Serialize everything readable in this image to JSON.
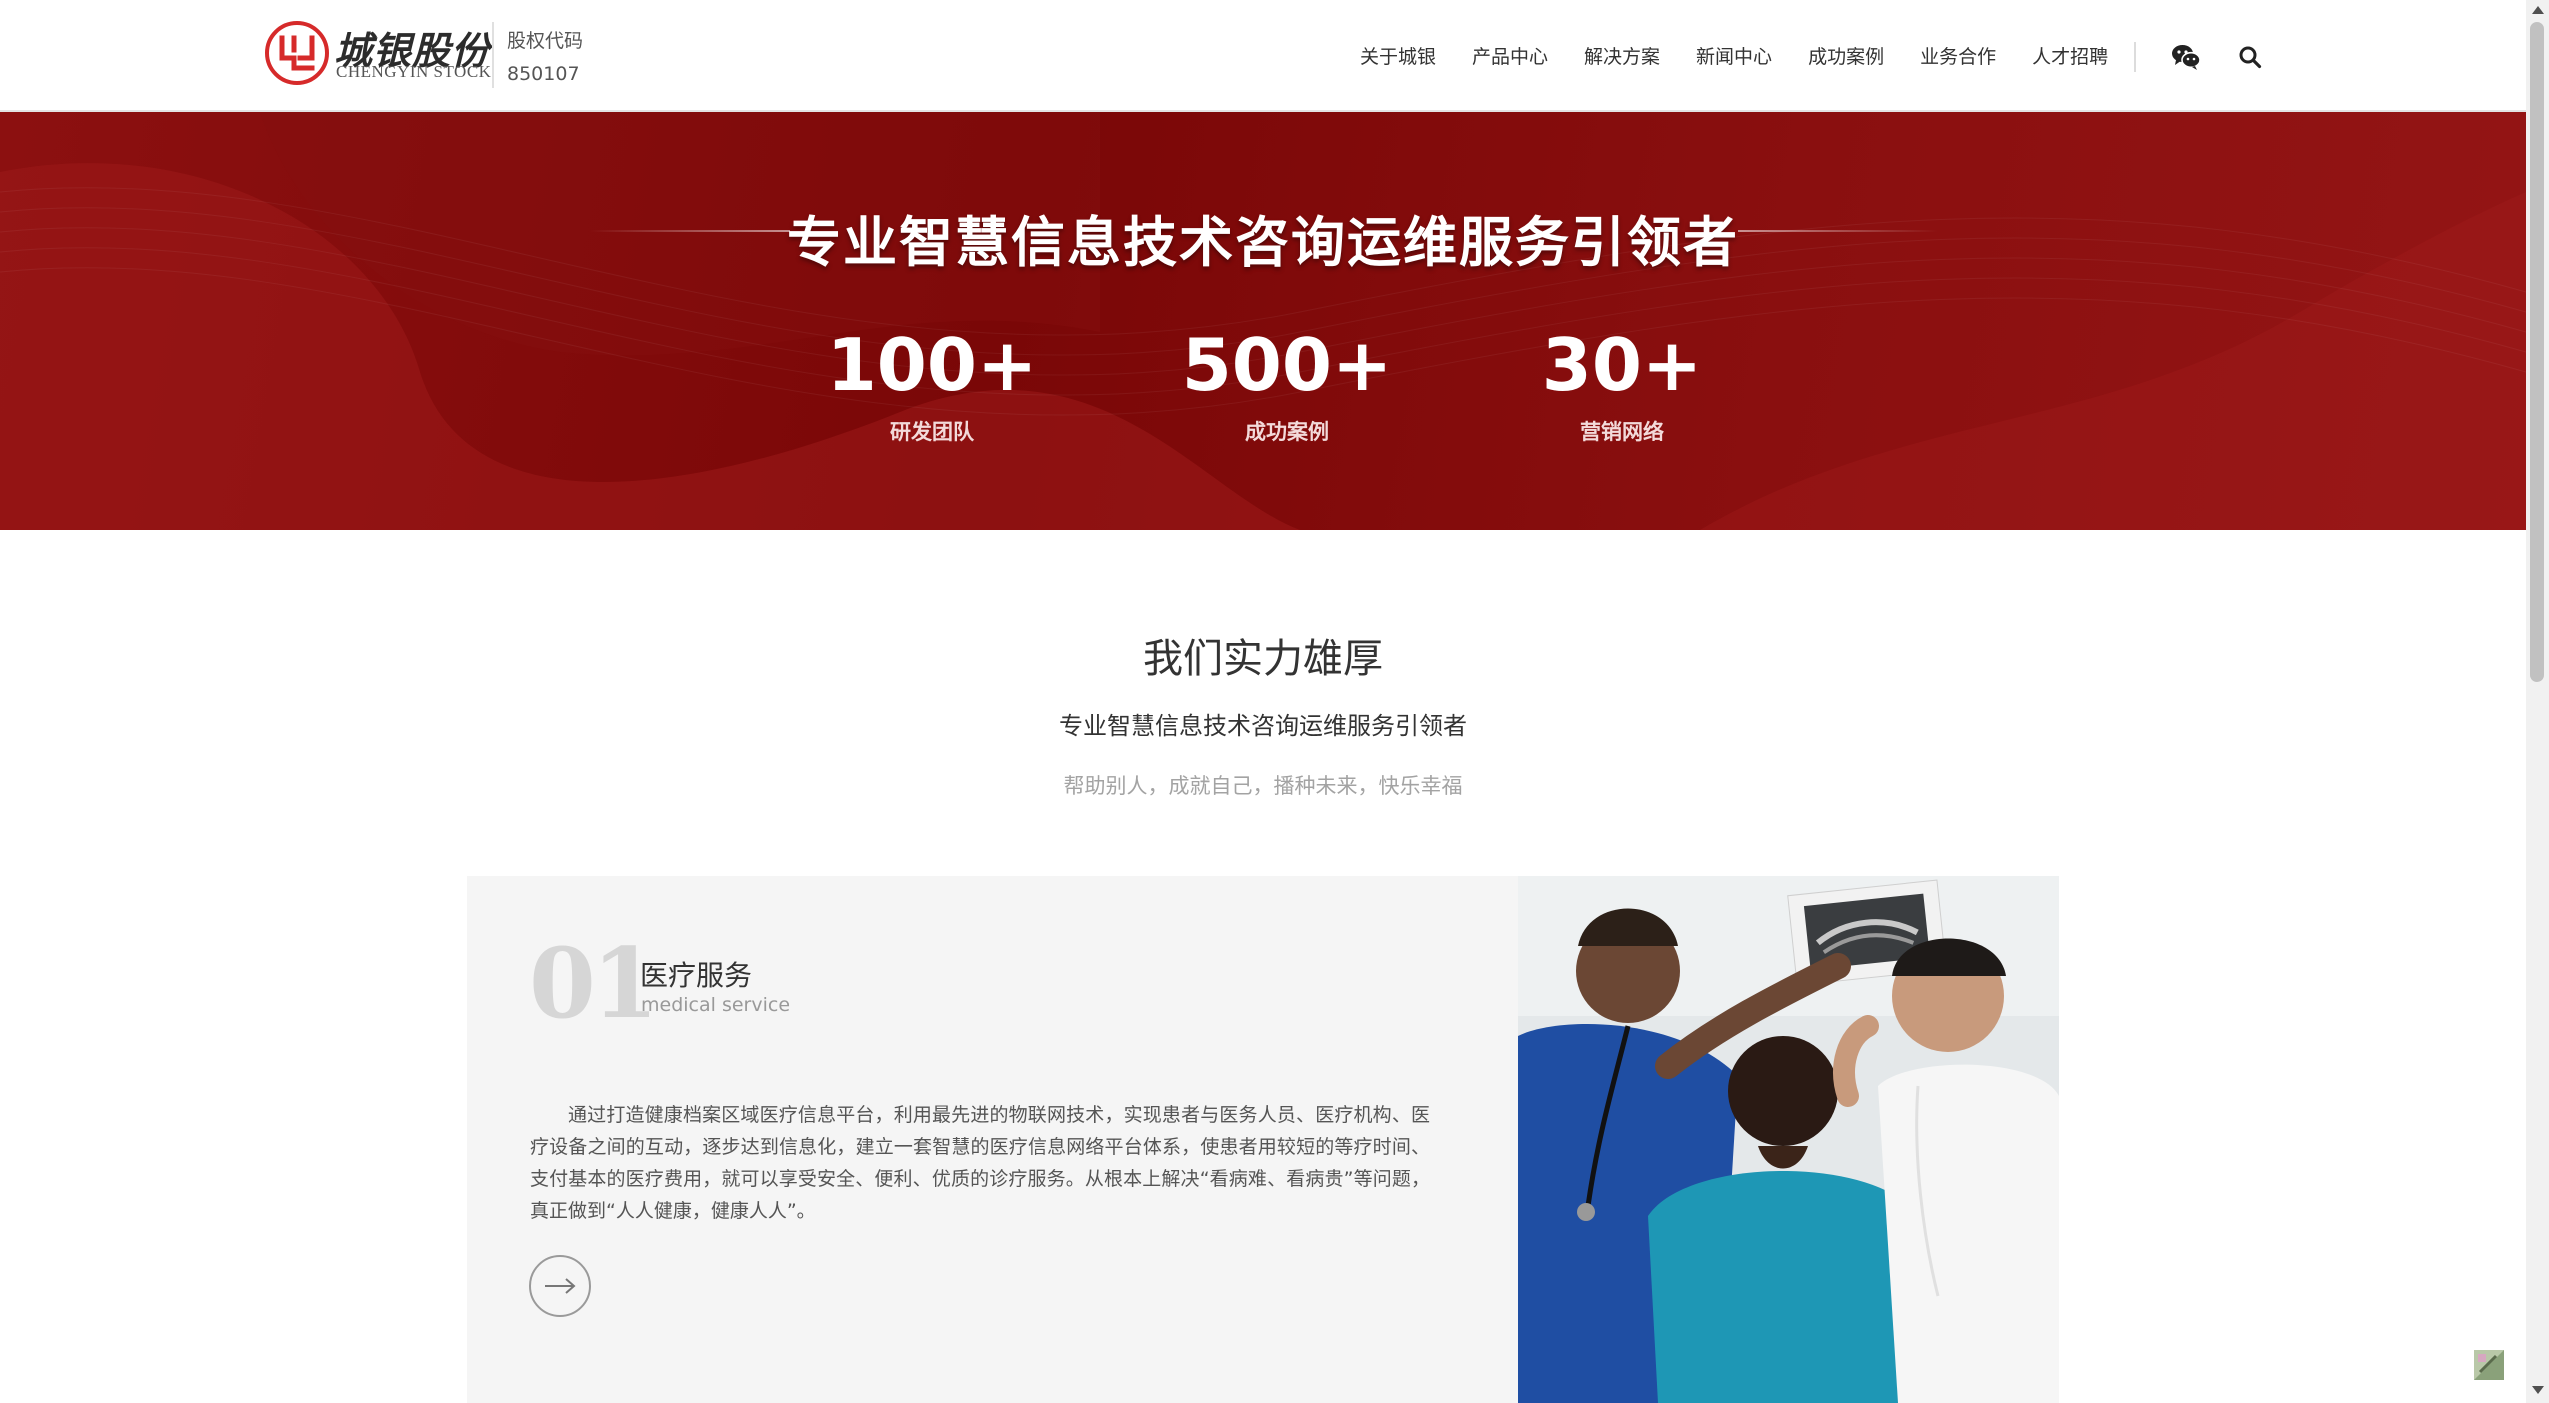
{
  "header": {
    "logo": {
      "name_cn": "城银股份",
      "name_en": "CHENGYIN STOCK"
    },
    "stock": {
      "label": "股权代码",
      "code": "850107"
    },
    "nav": [
      {
        "label": "关于城银"
      },
      {
        "label": "产品中心"
      },
      {
        "label": "解决方案"
      },
      {
        "label": "新闻中心"
      },
      {
        "label": "成功案例"
      },
      {
        "label": "业务合作"
      },
      {
        "label": "人才招聘"
      }
    ],
    "icons": {
      "social": "wechat-icon",
      "search": "search-icon"
    }
  },
  "banner": {
    "title": "专业智慧信息技术咨询运维服务引领者",
    "stats": [
      {
        "value": "100+",
        "label": "研发团队"
      },
      {
        "value": "500+",
        "label": "成功案例"
      },
      {
        "value": "30+",
        "label": "营销网络"
      }
    ]
  },
  "section": {
    "title": "我们实力雄厚",
    "subtitle": "专业智慧信息技术咨询运维服务引领者",
    "slogan": "帮助别人，成就自己，播种未来，快乐幸福"
  },
  "service": {
    "number": "01",
    "name": "医疗服务",
    "name_en": "medical service",
    "description": "通过打造健康档案区域医疗信息平台，利用最先进的物联网技术，实现患者与医务人员、医疗机构、医疗设备之间的互动，逐步达到信息化，建立一套智慧的医疗信息网络平台体系，使患者用较短的等疗时间、支付基本的医疗费用，就可以享受安全、便利、优质的诊疗服务。从根本上解决“看病难、看病贵”等问题，真正做到“人人健康，健康人人”。",
    "arrow_icon": "arrow-right-icon"
  },
  "colors": {
    "brand_red": "#7a0707",
    "logo_red": "#d62a2a",
    "card_bg": "#f5f5f5",
    "muted_text": "#a3a3a3"
  }
}
